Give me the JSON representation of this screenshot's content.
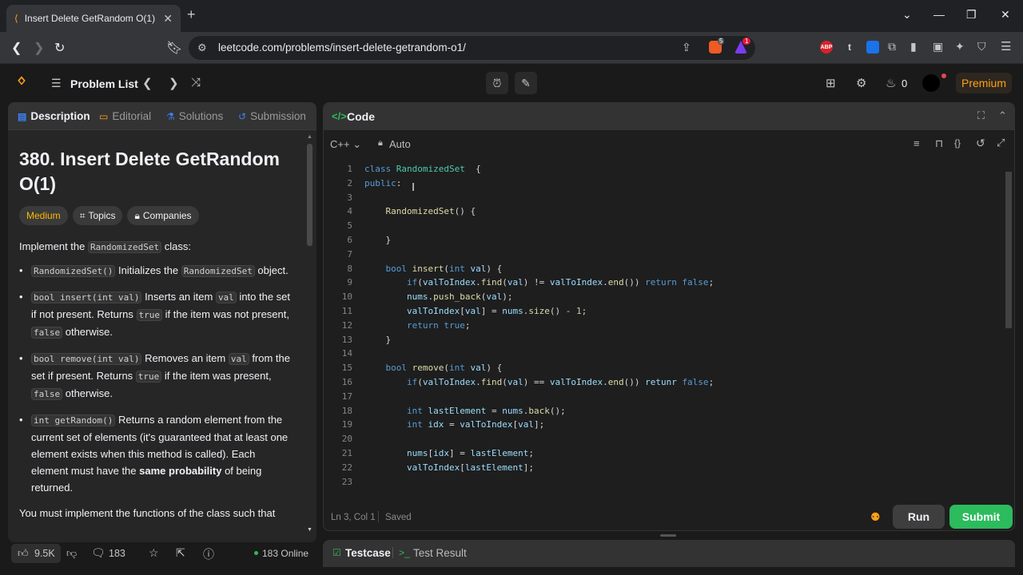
{
  "browser": {
    "tab_title": "Insert Delete GetRandom O(1)",
    "new_tab": "+",
    "url": "leetcode.com/problems/insert-delete-getrandom-o1/",
    "ext_abp": "ABP",
    "ext_t": "t",
    "brave_badge": "5",
    "rewards_badge": "1"
  },
  "nav": {
    "problem_list": "Problem List",
    "streak": "0",
    "premium": "Premium"
  },
  "left": {
    "tabs": [
      {
        "label": "Description",
        "icon": "description-icon"
      },
      {
        "label": "Editorial",
        "icon": "book-icon"
      },
      {
        "label": "Solutions",
        "icon": "flask-icon"
      },
      {
        "label": "Submission",
        "icon": "history-icon"
      }
    ],
    "title": "380. Insert Delete GetRandom O(1)",
    "tags": {
      "difficulty": "Medium",
      "topics": "Topics",
      "companies": "Companies"
    },
    "intro_pre": "Implement the ",
    "intro_code": "RandomizedSet",
    "intro_post": " class:",
    "items": [
      {
        "code": "RandomizedSet()",
        "t1": " Initializes the ",
        "c2": "RandomizedSet",
        "t2": " object."
      },
      {
        "code": "bool insert(int val)",
        "t1": " Inserts an item ",
        "c2": "val",
        "t2": " into the set if not present. Returns ",
        "c3": "true",
        "t3": " if the item was not present, ",
        "c4": "false",
        "t4": " otherwise."
      },
      {
        "code": "bool remove(int val)",
        "t1": " Removes an item ",
        "c2": "val",
        "t2": " from the set if present. Returns ",
        "c3": "true",
        "t3": " if the item was present, ",
        "c4": "false",
        "t4": " otherwise."
      },
      {
        "code": "int getRandom()",
        "t1": " Returns a random element from the current set of elements (it's guaranteed that at least one element exists when this method is called). Each element must have the ",
        "b": "same probability",
        "t2": " of being returned."
      }
    ],
    "trailing": "You must implement the functions of the class such that",
    "likes": "9.5K",
    "comments": "183",
    "online": "183 Online"
  },
  "right": {
    "header": "Code",
    "language": "C++",
    "mode": "Auto",
    "status_pos": "Ln 3, Col 1",
    "status_saved": "Saved",
    "run": "Run",
    "submit": "Submit",
    "testcase": "Testcase",
    "test_result": "Test Result"
  },
  "code_lines": [
    {
      "n": "1",
      "segs": [
        [
          "kw",
          "class "
        ],
        [
          "ty",
          "RandomizedSet"
        ],
        [
          "",
          "  {"
        ]
      ]
    },
    {
      "n": "2",
      "segs": [
        [
          "kw",
          "public"
        ],
        [
          "",
          ":"
        ]
      ]
    },
    {
      "n": "3",
      "segs": [
        [
          "",
          ""
        ]
      ]
    },
    {
      "n": "4",
      "segs": [
        [
          "",
          "    "
        ],
        [
          "fn",
          "RandomizedSet"
        ],
        [
          "",
          "() {"
        ]
      ]
    },
    {
      "n": "5",
      "segs": [
        [
          "",
          ""
        ]
      ]
    },
    {
      "n": "6",
      "segs": [
        [
          "",
          "    }"
        ]
      ]
    },
    {
      "n": "7",
      "segs": [
        [
          "",
          ""
        ]
      ]
    },
    {
      "n": "8",
      "segs": [
        [
          "",
          "    "
        ],
        [
          "kw",
          "bool "
        ],
        [
          "fn",
          "insert"
        ],
        [
          "",
          "("
        ],
        [
          "kw",
          "int "
        ],
        [
          "vr",
          "val"
        ],
        [
          "",
          ") {"
        ]
      ]
    },
    {
      "n": "9",
      "segs": [
        [
          "",
          "        "
        ],
        [
          "kw",
          "if"
        ],
        [
          "",
          "("
        ],
        [
          "vr",
          "valToIndex"
        ],
        [
          "",
          "."
        ],
        [
          "fn",
          "find"
        ],
        [
          "",
          "("
        ],
        [
          "vr",
          "val"
        ],
        [
          "",
          ") != "
        ],
        [
          "vr",
          "valToIndex"
        ],
        [
          "",
          "."
        ],
        [
          "fn",
          "end"
        ],
        [
          "",
          "()) "
        ],
        [
          "kw",
          "return false"
        ],
        [
          "",
          ";"
        ]
      ]
    },
    {
      "n": "10",
      "segs": [
        [
          "",
          "        "
        ],
        [
          "vr",
          "nums"
        ],
        [
          "",
          "."
        ],
        [
          "fn",
          "push_back"
        ],
        [
          "",
          "("
        ],
        [
          "vr",
          "val"
        ],
        [
          "",
          ");"
        ]
      ]
    },
    {
      "n": "11",
      "segs": [
        [
          "",
          "        "
        ],
        [
          "vr",
          "valToIndex"
        ],
        [
          "",
          "["
        ],
        [
          "vr",
          "val"
        ],
        [
          "",
          "] = "
        ],
        [
          "vr",
          "nums"
        ],
        [
          "",
          "."
        ],
        [
          "fn",
          "size"
        ],
        [
          "",
          "() - "
        ],
        [
          "nm",
          "1"
        ],
        [
          "",
          ";"
        ]
      ]
    },
    {
      "n": "12",
      "segs": [
        [
          "",
          "        "
        ],
        [
          "kw",
          "return true"
        ],
        [
          "",
          ";"
        ]
      ]
    },
    {
      "n": "13",
      "segs": [
        [
          "",
          "    }"
        ]
      ]
    },
    {
      "n": "14",
      "segs": [
        [
          "",
          ""
        ]
      ]
    },
    {
      "n": "15",
      "segs": [
        [
          "",
          "    "
        ],
        [
          "kw",
          "bool "
        ],
        [
          "fn",
          "remove"
        ],
        [
          "",
          "("
        ],
        [
          "kw",
          "int "
        ],
        [
          "vr",
          "val"
        ],
        [
          "",
          ") {"
        ]
      ]
    },
    {
      "n": "16",
      "segs": [
        [
          "",
          "        "
        ],
        [
          "kw",
          "if"
        ],
        [
          "",
          "("
        ],
        [
          "vr",
          "valToIndex"
        ],
        [
          "",
          "."
        ],
        [
          "fn",
          "find"
        ],
        [
          "",
          "("
        ],
        [
          "vr",
          "val"
        ],
        [
          "",
          ") == "
        ],
        [
          "vr",
          "valToIndex"
        ],
        [
          "",
          "."
        ],
        [
          "fn",
          "end"
        ],
        [
          "",
          "()) "
        ],
        [
          "vr",
          "retunr "
        ],
        [
          "kw",
          "false"
        ],
        [
          "",
          ";"
        ]
      ]
    },
    {
      "n": "17",
      "segs": [
        [
          "",
          ""
        ]
      ]
    },
    {
      "n": "18",
      "segs": [
        [
          "",
          "        "
        ],
        [
          "kw",
          "int "
        ],
        [
          "vr",
          "lastElement"
        ],
        [
          "",
          " = "
        ],
        [
          "vr",
          "nums"
        ],
        [
          "",
          "."
        ],
        [
          "fn",
          "back"
        ],
        [
          "",
          "();"
        ]
      ]
    },
    {
      "n": "19",
      "segs": [
        [
          "",
          "        "
        ],
        [
          "kw",
          "int "
        ],
        [
          "vr",
          "idx"
        ],
        [
          "",
          " = "
        ],
        [
          "vr",
          "valToIndex"
        ],
        [
          "",
          "["
        ],
        [
          "vr",
          "val"
        ],
        [
          "",
          "];"
        ]
      ]
    },
    {
      "n": "20",
      "segs": [
        [
          "",
          ""
        ]
      ]
    },
    {
      "n": "21",
      "segs": [
        [
          "",
          "        "
        ],
        [
          "vr",
          "nums"
        ],
        [
          "",
          "["
        ],
        [
          "vr",
          "idx"
        ],
        [
          "",
          "] = "
        ],
        [
          "vr",
          "lastElement"
        ],
        [
          "",
          ";"
        ]
      ]
    },
    {
      "n": "22",
      "segs": [
        [
          "",
          "        "
        ],
        [
          "vr",
          "valToIndex"
        ],
        [
          "",
          "["
        ],
        [
          "vr",
          "lastElement"
        ],
        [
          "",
          "];"
        ]
      ]
    },
    {
      "n": "23",
      "segs": [
        [
          "",
          ""
        ]
      ]
    }
  ]
}
